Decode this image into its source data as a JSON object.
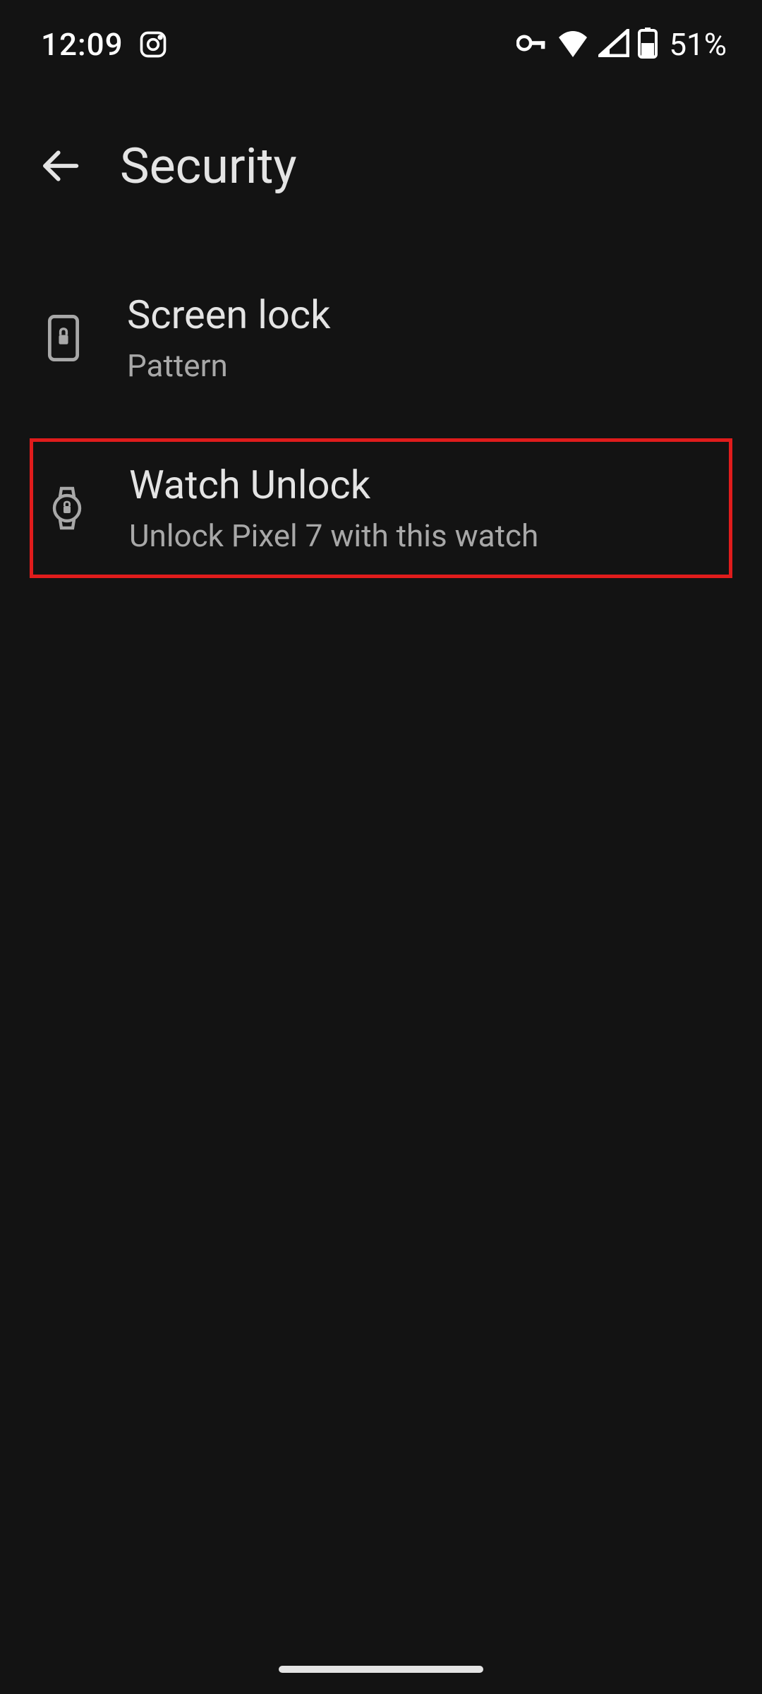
{
  "status": {
    "time": "12:09",
    "battery_percent": "51%"
  },
  "header": {
    "title": "Security"
  },
  "settings": {
    "screen_lock": {
      "title": "Screen lock",
      "subtitle": "Pattern"
    },
    "watch_unlock": {
      "title": "Watch Unlock",
      "subtitle": "Unlock Pixel 7 with this watch"
    }
  },
  "colors": {
    "background": "#131313",
    "text_primary": "#e4e4e4",
    "text_secondary": "#a8a8a8",
    "highlight_border": "#e01c1c"
  }
}
